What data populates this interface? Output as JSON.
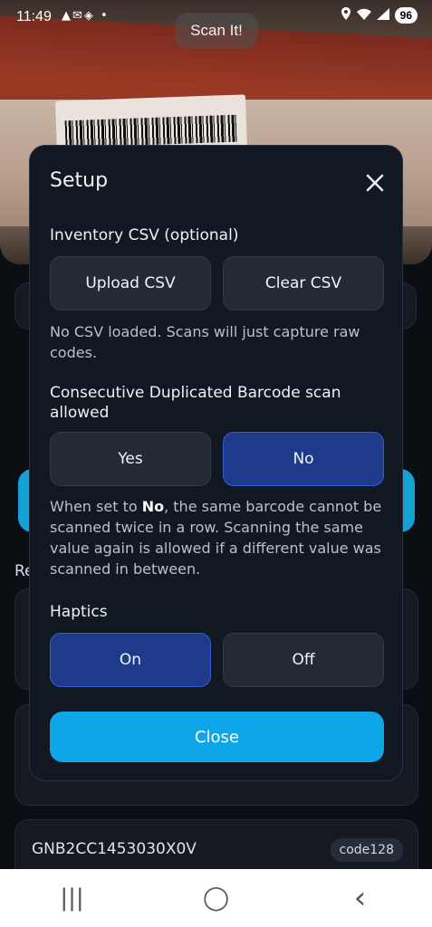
{
  "status": {
    "time": "11:49",
    "left_icons": "▲✉◈ •",
    "battery": "96"
  },
  "header": {
    "scan_pill": "Scan It!"
  },
  "background": {
    "recent_label": "Re",
    "last_card_code": "GNB2CC1453030X0V",
    "last_card_badge": "code128"
  },
  "modal": {
    "title": "Setup",
    "inventory": {
      "label": "Inventory CSV (optional)",
      "upload_label": "Upload CSV",
      "clear_label": "Clear CSV",
      "status_text": "No CSV loaded. Scans will just capture raw codes."
    },
    "duplicates": {
      "label": "Consecutive Duplicated Barcode scan allowed",
      "yes_label": "Yes",
      "no_label": "No",
      "selected": "No",
      "help_prefix": "When set to ",
      "help_bold": "No",
      "help_suffix": ", the same barcode cannot be scanned twice in a row. Scanning the same value again is allowed if a different value was scanned in between."
    },
    "haptics": {
      "label": "Haptics",
      "on_label": "On",
      "off_label": "Off",
      "selected": "On"
    },
    "close_label": "Close"
  },
  "navbar": {
    "recents": "|||",
    "home": "◯",
    "back": "‹"
  },
  "colors": {
    "accent": "#0ea5e9",
    "selected": "#1e3a8a",
    "modal_bg": "#121821",
    "button_bg": "#222a35"
  }
}
